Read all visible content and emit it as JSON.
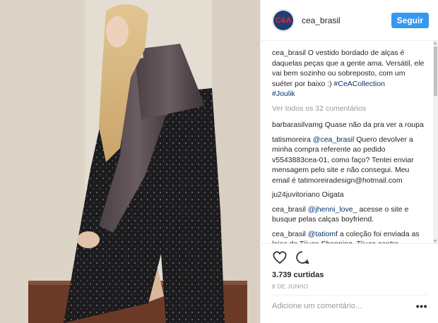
{
  "post": {
    "username": "cea_brasil",
    "avatar_text": "C&A",
    "follow_label": "Seguir",
    "caption": {
      "user": "cea_brasil",
      "text": "O vestido bordado de alças é daquelas peças que a gente ama. Versátil, ele vai bem sozinho ou sobreposto, com um suéter por baixo :) ",
      "hashtag1": "#CeACollection",
      "hashtag2": "#Joulik"
    },
    "view_all_comments": "Ver todos os 32 comentários",
    "comments": [
      {
        "user": "barbarasilvamg",
        "mention": "",
        "text": "Quase não da pra ver a roupa"
      },
      {
        "user": "tatismoreira",
        "mention": "@cea_brasil",
        "text": " Quero devolver a minha compra referente ao pedido v5543883cea-01, como faço? Tentei enviar mensagem pelo site e não consegui. Meu email é tatimoreiradesign@hotmail.com"
      },
      {
        "user": "ju24juvitoriano",
        "mention": "",
        "text": "Oigata"
      },
      {
        "user": "cea_brasil",
        "mention": "@jhenni_love_",
        "text": " acesse o site e busque pelas calças boyfriend."
      },
      {
        "user": "cea_brasil",
        "mention": "@tatiomf",
        "text": " a coleção foi enviada as lojas do Tijuca Shopping, Tijuca centro,"
      }
    ],
    "likes": "3.739 curtidas",
    "date": "8 DE JUNHO",
    "comment_placeholder": "Adicione um comentário...",
    "more_label": "•••"
  },
  "colors": {
    "accent": "#3897f0",
    "link": "#003569",
    "muted": "#999999",
    "brand_blue": "#1f3f73",
    "brand_red": "#e8262b"
  },
  "icons": [
    "heart-icon",
    "comment-icon",
    "more-options-icon"
  ]
}
